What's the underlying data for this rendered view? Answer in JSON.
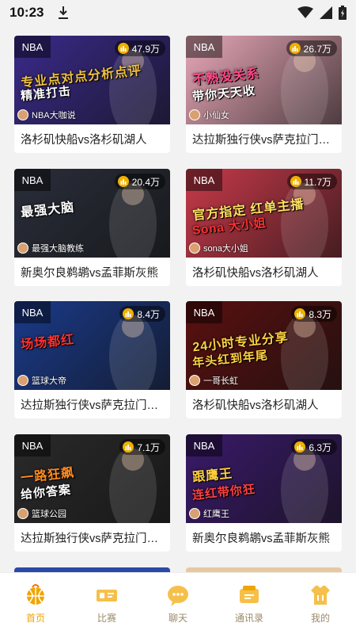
{
  "status_bar": {
    "time": "10:23",
    "icons": [
      "download-icon",
      "wifi-icon",
      "signal-icon",
      "battery-icon"
    ]
  },
  "colors": {
    "accent": "#f0a500",
    "tab_inactive": "#9a8a6a",
    "background": "#f2f2f2"
  },
  "cards": [
    {
      "tag": "NBA",
      "viewers": "47.9万",
      "streamer": "NBA大咖说",
      "headline1": "专业点对点分析点评",
      "headline2": "精准打击",
      "title": "洛杉矶快船vs洛杉矶湖人",
      "bg": "#3a2a8a"
    },
    {
      "tag": "NBA",
      "viewers": "26.7万",
      "streamer": "小仙女",
      "headline1": "不熟没关系",
      "headline2": "带你天天收",
      "title": "达拉斯独行侠vs萨克拉门托国王",
      "bg": "#e8a8b8"
    },
    {
      "tag": "NBA",
      "viewers": "20.4万",
      "streamer": "最强大脑教练",
      "headline1": "最强大脑",
      "headline2": "",
      "title": "新奥尔良鹈鹕vs孟菲斯灰熊",
      "bg": "#2a2e3a"
    },
    {
      "tag": "NBA",
      "viewers": "11.7万",
      "streamer": "sona大小姐",
      "headline1": "官方指定 红单主播",
      "headline2": "Sona 大小姐",
      "title": "洛杉矶快船vs洛杉矶湖人",
      "bg": "#c83a4a"
    },
    {
      "tag": "NBA",
      "viewers": "8.4万",
      "streamer": "篮球大帝",
      "headline1": "场场都红",
      "headline2": "",
      "title": "达拉斯独行侠vs萨克拉门托国王",
      "bg": "#1a3a8a"
    },
    {
      "tag": "NBA",
      "viewers": "8.3万",
      "streamer": "一哥长虹",
      "headline1": "24小时专业分享",
      "headline2": "年头红到年尾",
      "title": "洛杉矶快船vs洛杉矶湖人",
      "bg": "#5a1010"
    },
    {
      "tag": "NBA",
      "viewers": "7.1万",
      "streamer": "篮球公园",
      "headline1": "一路狂飙",
      "headline2": "给你答案",
      "title": "达拉斯独行侠vs萨克拉门托国王",
      "bg": "#2a2a2a"
    },
    {
      "tag": "NBA",
      "viewers": "6.3万",
      "streamer": "红鹰王",
      "headline1": "跟鹰王",
      "headline2": "连红带你狂",
      "title": "新奥尔良鹈鹕vs孟菲斯灰熊",
      "bg": "#3a1a6a"
    }
  ],
  "tabs": [
    {
      "label": "首页",
      "icon": "basketball-home-icon",
      "active": true
    },
    {
      "label": "比赛",
      "icon": "ticket-icon",
      "active": false
    },
    {
      "label": "聊天",
      "icon": "chat-bubble-icon",
      "active": false
    },
    {
      "label": "通讯录",
      "icon": "contacts-icon",
      "active": false
    },
    {
      "label": "我的",
      "icon": "jersey-icon",
      "active": false
    }
  ]
}
